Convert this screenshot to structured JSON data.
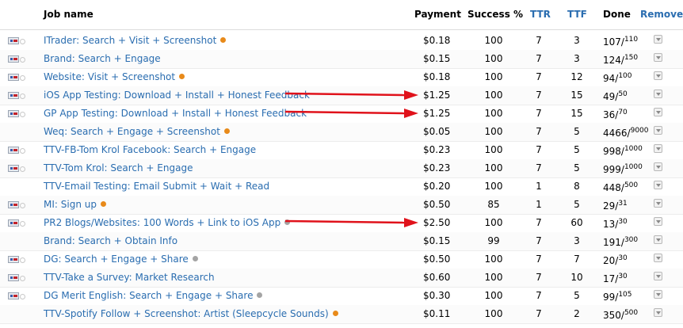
{
  "header": {
    "job_name": "Job name",
    "payment": "Payment",
    "success": "Success %",
    "ttr": "TTR",
    "ttf": "TTF",
    "done": "Done",
    "remove": "Remove"
  },
  "rows": [
    {
      "flag": true,
      "name": "ITrader: Search + Visit + Screenshot",
      "dot": "orange",
      "payment": "$0.18",
      "success": "100",
      "ttr": "7",
      "ttf": "3",
      "done": "107",
      "total": "110"
    },
    {
      "flag": true,
      "name": "Brand: Search + Engage",
      "dot": "",
      "payment": "$0.15",
      "success": "100",
      "ttr": "7",
      "ttf": "3",
      "done": "124",
      "total": "150"
    },
    {
      "flag": true,
      "name": "Website: Visit + Screenshot",
      "dot": "orange",
      "payment": "$0.18",
      "success": "100",
      "ttr": "7",
      "ttf": "12",
      "done": "94",
      "total": "100"
    },
    {
      "flag": true,
      "name": "iOS App Testing: Download + Install + Honest Feedback",
      "dot": "",
      "payment": "$1.25",
      "success": "100",
      "ttr": "7",
      "ttf": "15",
      "done": "49",
      "total": "50"
    },
    {
      "flag": true,
      "name": "GP App Testing: Download + Install + Honest Feedback",
      "dot": "",
      "payment": "$1.25",
      "success": "100",
      "ttr": "7",
      "ttf": "15",
      "done": "36",
      "total": "70"
    },
    {
      "flag": false,
      "name": "Weq: Search + Engage + Screenshot",
      "dot": "orange",
      "payment": "$0.05",
      "success": "100",
      "ttr": "7",
      "ttf": "5",
      "done": "4466",
      "total": "9000"
    },
    {
      "flag": true,
      "name": "TTV-FB-Tom Krol Facebook: Search + Engage",
      "dot": "",
      "payment": "$0.23",
      "success": "100",
      "ttr": "7",
      "ttf": "5",
      "done": "998",
      "total": "1000"
    },
    {
      "flag": true,
      "name": "TTV-Tom Krol: Search + Engage",
      "dot": "",
      "payment": "$0.23",
      "success": "100",
      "ttr": "7",
      "ttf": "5",
      "done": "999",
      "total": "1000"
    },
    {
      "flag": false,
      "name": "TTV-Email Testing: Email Submit + Wait + Read",
      "dot": "",
      "payment": "$0.20",
      "success": "100",
      "ttr": "1",
      "ttf": "8",
      "done": "448",
      "total": "500"
    },
    {
      "flag": true,
      "name": "MI: Sign up",
      "dot": "orange",
      "payment": "$0.50",
      "success": "85",
      "ttr": "1",
      "ttf": "5",
      "done": "29",
      "total": "31"
    },
    {
      "flag": true,
      "name": "PR2 Blogs/Websites: 100 Words + Link to iOS App",
      "dot": "gray",
      "payment": "$2.50",
      "success": "100",
      "ttr": "7",
      "ttf": "60",
      "done": "13",
      "total": "30"
    },
    {
      "flag": false,
      "name": "Brand: Search + Obtain Info",
      "dot": "",
      "payment": "$0.15",
      "success": "99",
      "ttr": "7",
      "ttf": "3",
      "done": "191",
      "total": "300"
    },
    {
      "flag": true,
      "name": "DG: Search + Engage + Share",
      "dot": "gray",
      "payment": "$0.50",
      "success": "100",
      "ttr": "7",
      "ttf": "7",
      "done": "20",
      "total": "30"
    },
    {
      "flag": true,
      "name": "TTV-Take a Survey: Market Research",
      "dot": "",
      "payment": "$0.60",
      "success": "100",
      "ttr": "7",
      "ttf": "10",
      "done": "17",
      "total": "30"
    },
    {
      "flag": true,
      "name": "DG Merit English: Search + Engage + Share",
      "dot": "gray",
      "payment": "$0.30",
      "success": "100",
      "ttr": "7",
      "ttf": "5",
      "done": "99",
      "total": "105"
    },
    {
      "flag": false,
      "name": "TTV-Spotify Follow + Screenshot: Artist (Sleepcycle Sounds)",
      "dot": "orange",
      "payment": "$0.11",
      "success": "100",
      "ttr": "7",
      "ttf": "2",
      "done": "350",
      "total": "500"
    }
  ],
  "annotation_color": "#e0121b",
  "arrow_rows": [
    3,
    4,
    10
  ]
}
